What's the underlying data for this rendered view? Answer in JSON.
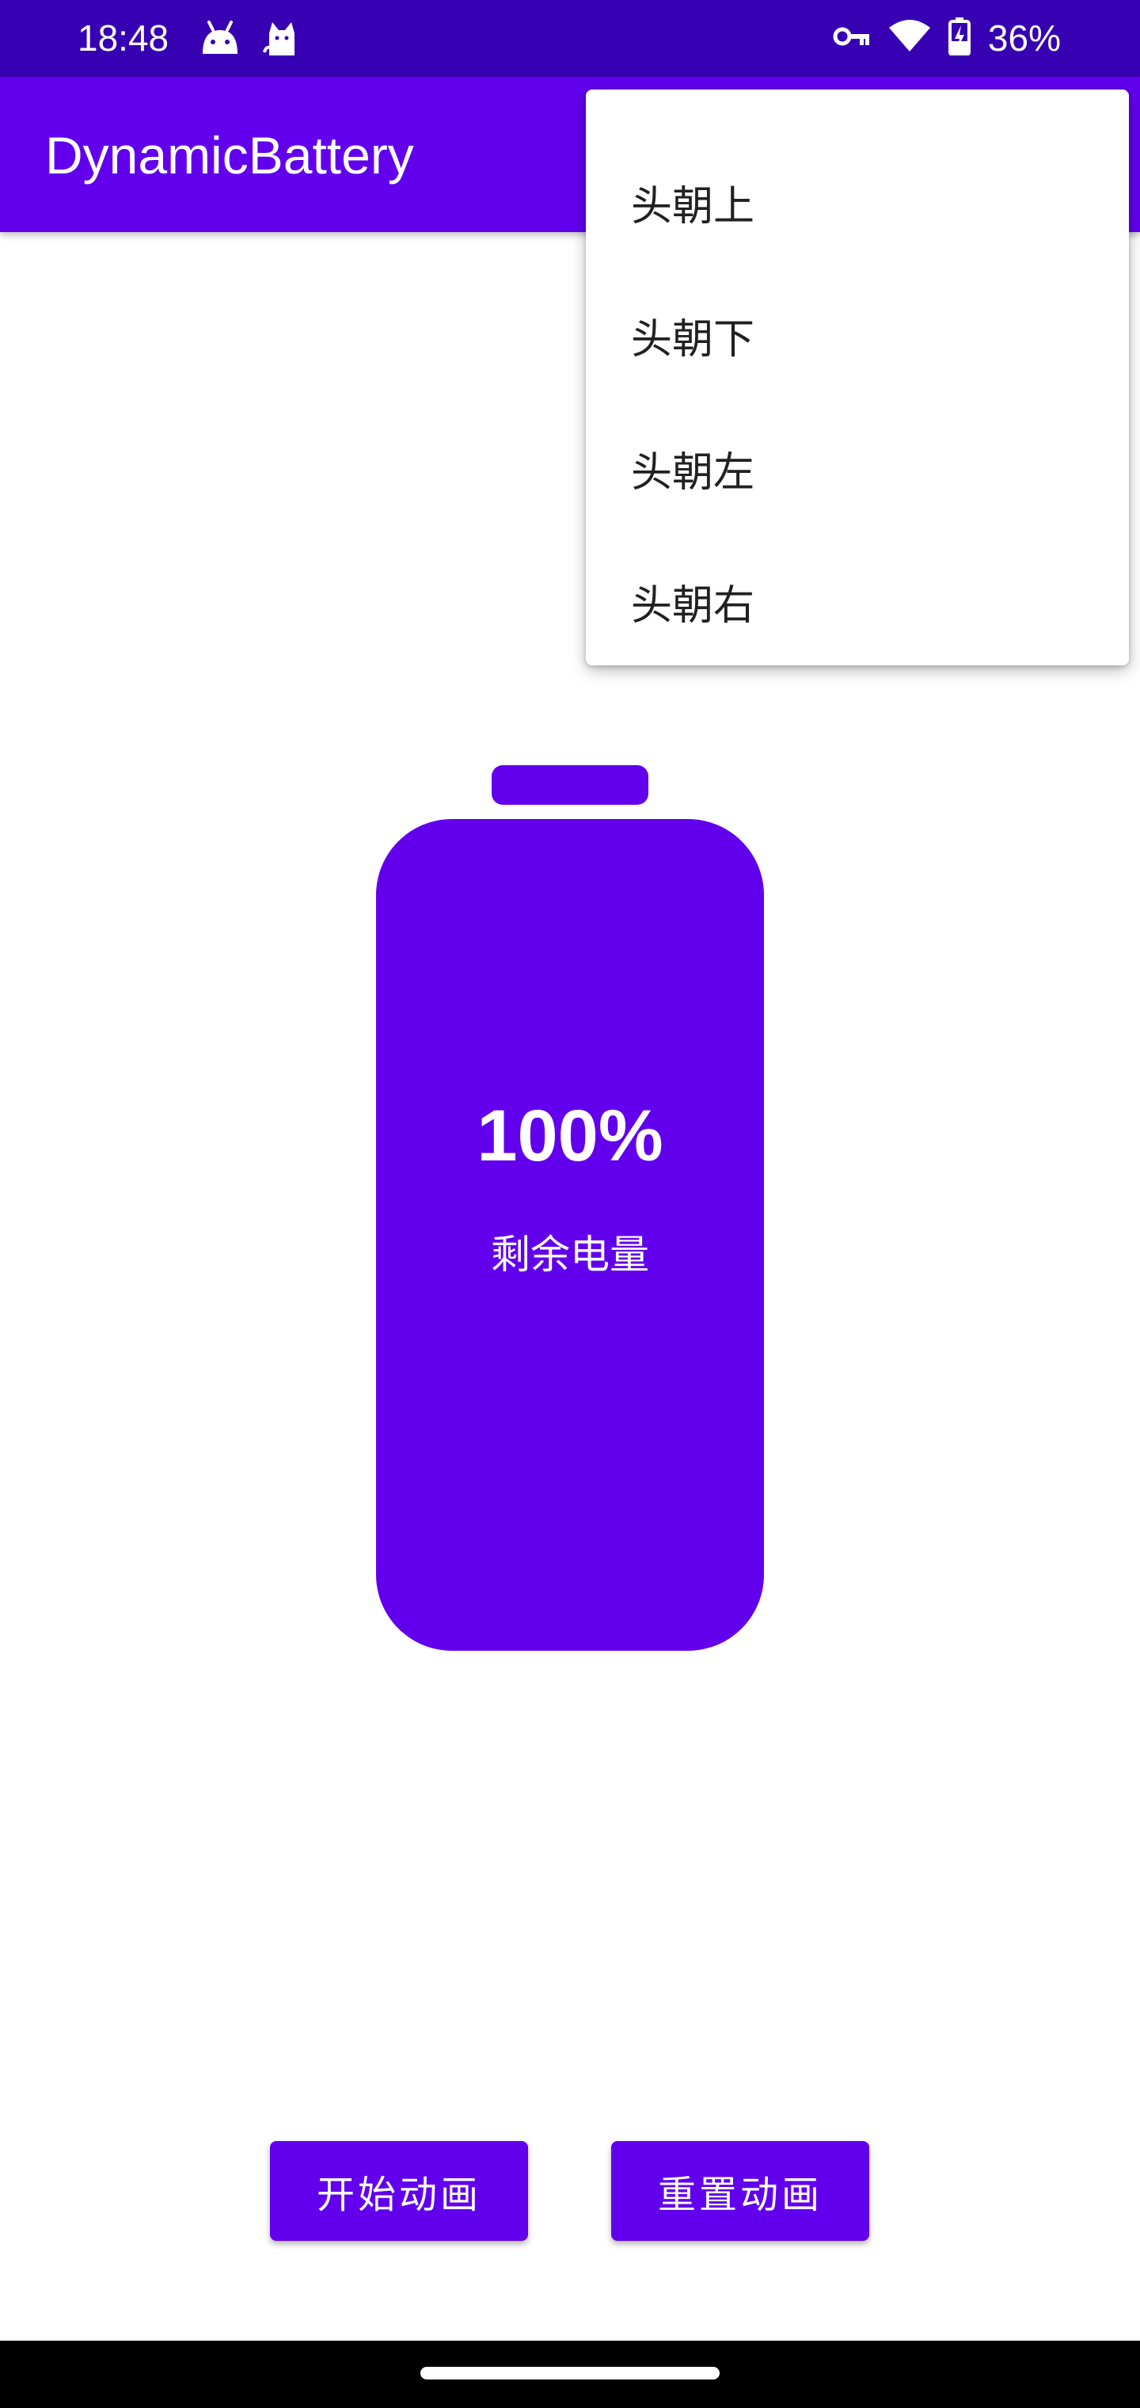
{
  "status_bar": {
    "time": "18:48",
    "battery_text": "36%",
    "left_icons": [
      "android-icon",
      "cat-icon"
    ],
    "right_icons": [
      "vpn-key-icon",
      "wifi-icon",
      "battery-charging-icon"
    ]
  },
  "app_bar": {
    "title": "DynamicBattery"
  },
  "menu": {
    "items": [
      {
        "label": "头朝上"
      },
      {
        "label": "头朝下"
      },
      {
        "label": "头朝左"
      },
      {
        "label": "头朝右"
      }
    ]
  },
  "battery": {
    "percent_text": "100%",
    "label": "剩余电量",
    "level": 1.0,
    "color": "#6200ee"
  },
  "buttons": {
    "start_label": "开始动画",
    "reset_label": "重置动画"
  },
  "colors": {
    "status_bar": "#3700b3",
    "primary": "#6200ee",
    "nav_bar": "#000000"
  }
}
